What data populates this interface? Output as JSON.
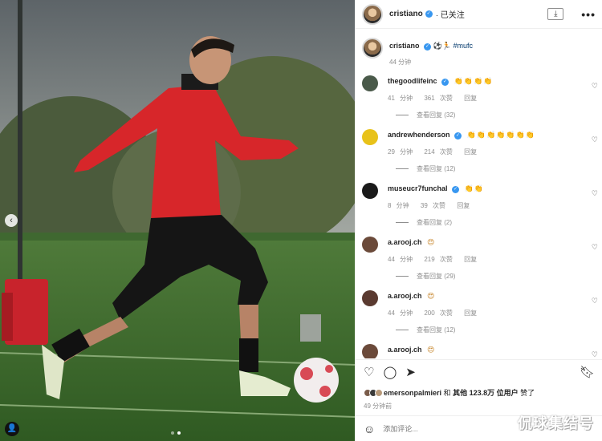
{
  "post": {
    "author": "cristiano",
    "follow_status": "已关注",
    "caption_icons": "⚽🏃",
    "caption_tag": "#mufc",
    "caption_time": "44 分钟"
  },
  "header": {
    "download_icon": "download-icon",
    "more_label": "•••"
  },
  "comments": [
    {
      "user": "thegoodlifeinc",
      "verified": true,
      "text": "👏👏👏👏",
      "time": "41 分钟",
      "likes": "361 次赞",
      "reply": "回复",
      "view_replies": "查看回复 (32)"
    },
    {
      "user": "andrewhenderson",
      "verified": true,
      "text": "👏👏👏👏👏👏👏",
      "time": "29 分钟",
      "likes": "214 次赞",
      "reply": "回复",
      "view_replies": "查看回复 (12)"
    },
    {
      "user": "museucr7funchal",
      "verified": true,
      "text": "👏👏",
      "time": "8 分钟",
      "likes": "39 次赞",
      "reply": "回复",
      "view_replies": "查看回复 (2)"
    },
    {
      "user": "a.arooj.ch",
      "verified": false,
      "text": "😍",
      "time": "44 分钟",
      "likes": "219 次赞",
      "reply": "回复",
      "view_replies": "查看回复 (29)"
    },
    {
      "user": "a.arooj.ch",
      "verified": false,
      "text": "😍",
      "time": "44 分钟",
      "likes": "200 次赞",
      "reply": "回复",
      "view_replies": "查看回复 (12)"
    },
    {
      "user": "a.arooj.ch",
      "verified": false,
      "text": "😍",
      "time": "",
      "likes": "",
      "reply": "",
      "view_replies": ""
    }
  ],
  "likes_line": {
    "liker": "emersonpalmieri",
    "connector": "和",
    "others": "其他 123.8万 位用户",
    "suffix": "赞了"
  },
  "posted_time": "49 分钟前",
  "comment_input": {
    "placeholder": "添加评论..."
  },
  "watermark": "侃球集结号",
  "icons": {
    "like": "heart-icon",
    "comment": "comment-icon",
    "share": "share-icon",
    "save": "bookmark-icon",
    "emoji": "smile-icon"
  },
  "colors": {
    "accent": "#3897f0",
    "link": "#00376b",
    "muted": "#8e8e8e"
  }
}
